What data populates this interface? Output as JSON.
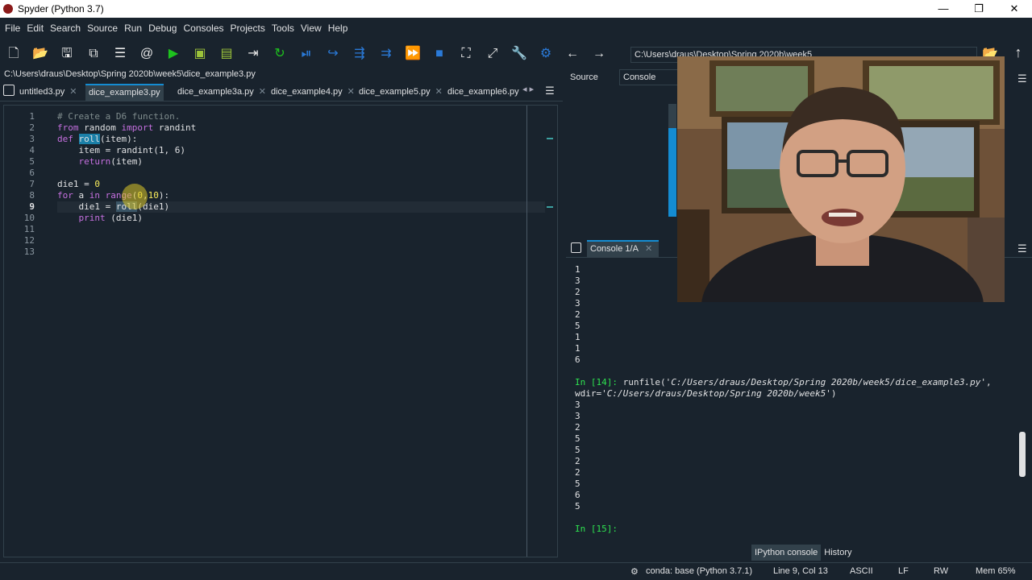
{
  "window": {
    "title": "Spyder (Python 3.7)",
    "controls": [
      "—",
      "❐",
      "✕"
    ]
  },
  "menu": [
    "File",
    "Edit",
    "Search",
    "Source",
    "Run",
    "Debug",
    "Consoles",
    "Projects",
    "Tools",
    "View",
    "Help"
  ],
  "toolbar": {
    "icons": [
      "new-file-icon",
      "open-folder-icon",
      "save-icon",
      "save-all-icon",
      "list-icon",
      "at-icon",
      "run-icon",
      "run-cell-icon",
      "run-cell-advance-icon",
      "run-selection-icon",
      "rerun-icon",
      "debug-icon",
      "step-icon",
      "step-into-icon",
      "step-return-icon",
      "continue-icon",
      "stop-icon",
      "maximize-pane-icon",
      "fullscreen-icon",
      "preferences-icon",
      "python-path-icon",
      "back-icon",
      "forward-icon"
    ],
    "working_dir": "C:\\Users\\draus\\Desktop\\Spring 2020b\\week5"
  },
  "editor": {
    "file_path": "C:\\Users\\draus\\Desktop\\Spring 2020b\\week5\\dice_example3.py",
    "tabs": [
      {
        "label": "untitled3.py",
        "active": false
      },
      {
        "label": "dice_example3.py",
        "active": true
      },
      {
        "label": "dice_example3a.py",
        "active": false
      },
      {
        "label": "dice_example4.py",
        "active": false
      },
      {
        "label": "dice_example5.py",
        "active": false
      },
      {
        "label": "dice_example6.py",
        "active": false
      }
    ],
    "line_numbers": [
      "1",
      "2",
      "3",
      "4",
      "5",
      "6",
      "7",
      "8",
      "9",
      "10",
      "11",
      "12",
      "13"
    ],
    "current_line": "9",
    "code": {
      "l1": "# Create a D6 function.",
      "l2_kw1": "from",
      "l2_mod": " random ",
      "l2_kw2": "import",
      "l2_name": " randint",
      "l3_kw": "def",
      "l3_fn": "roll",
      "l3_rest": "(item):",
      "l4": "    item = randint(1, 6)",
      "l5_kw": "return",
      "l5_rest": "(item)",
      "l7_a": "die1 = ",
      "l7_n": "0",
      "l8_kw1": "for",
      "l8_a": " a ",
      "l8_kw2": "in",
      "l8_sp": " ",
      "l8_bi": "range",
      "l8_p": "(",
      "l8_n1": "0",
      "l8_c": ",",
      "l8_n2": "10",
      "l8_e": "):",
      "l9_a": "    die1 = ",
      "l9_fn": "roll",
      "l9_rest": "(die1)",
      "l10_bi": "print",
      "l10_rest": " (die1)"
    }
  },
  "help_pane": {
    "source_label": "Source",
    "source_value": "Console"
  },
  "console": {
    "tab_label": "Console 1/A",
    "output_first": [
      "1",
      "3",
      "2",
      "3",
      "2",
      "5",
      "1",
      "1",
      "6"
    ],
    "run_prompt": "In [14]:",
    "run_cmd_a": " runfile(",
    "run_str1": "'C:/Users/draus/Desktop/Spring 2020b/week5/dice_example3.py'",
    "run_comma": ",",
    "run_wdir": "wdir=",
    "run_str2": "'C:/Users/draus/Desktop/Spring 2020b/week5'",
    "run_close": ")",
    "output_second": [
      "3",
      "3",
      "2",
      "5",
      "5",
      "2",
      "2",
      "5",
      "6",
      "5"
    ],
    "next_prompt": "In [15]:",
    "bottom_tabs": [
      "IPython console",
      "History"
    ]
  },
  "status": {
    "env": "conda: base (Python 3.7.1)",
    "position": "Line 9, Col 13",
    "encoding": "ASCII",
    "eol": "LF",
    "perm": "RW",
    "mem": "Mem 65%"
  }
}
